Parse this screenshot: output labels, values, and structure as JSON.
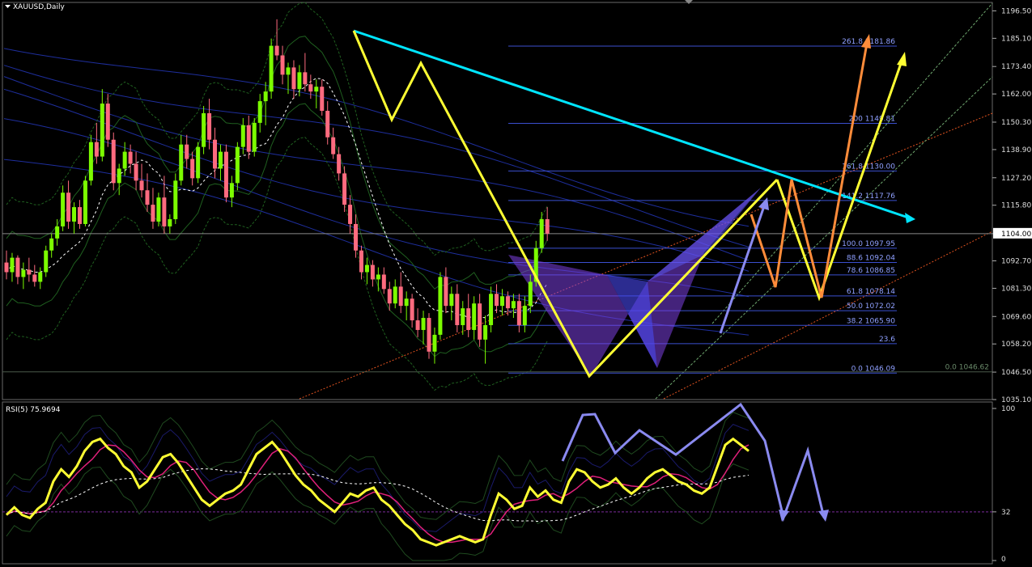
{
  "window": {
    "title": "XAUUSD,Daily",
    "menu_arrow_icon": "triangle-down-icon"
  },
  "chart_data": [
    {
      "type": "candlestick",
      "title": "XAUUSD,Daily",
      "symbol": "XAUUSD",
      "timeframe": "Daily",
      "ylim": [
        1035.1,
        1200.0
      ],
      "price_ticks": [
        "1196.50",
        "1185.10",
        "1173.40",
        "1162.00",
        "1150.30",
        "1138.90",
        "1127.20",
        "1115.80",
        "1104.00",
        "1092.70",
        "1081.30",
        "1069.60",
        "1058.20",
        "1046.50",
        "1035.10"
      ],
      "current_price": "1104.00",
      "candles_ohlc": [
        [
          1092,
          1097,
          1085,
          1088
        ],
        [
          1088,
          1096,
          1084,
          1094
        ],
        [
          1094,
          1095,
          1083,
          1086
        ],
        [
          1086,
          1092,
          1081,
          1089
        ],
        [
          1089,
          1094,
          1084,
          1087
        ],
        [
          1087,
          1091,
          1082,
          1084
        ],
        [
          1084,
          1090,
          1081,
          1088
        ],
        [
          1088,
          1099,
          1086,
          1097
        ],
        [
          1097,
          1104,
          1094,
          1102
        ],
        [
          1102,
          1110,
          1099,
          1107
        ],
        [
          1107,
          1124,
          1105,
          1121
        ],
        [
          1121,
          1126,
          1106,
          1109
        ],
        [
          1109,
          1117,
          1104,
          1115
        ],
        [
          1115,
          1118,
          1106,
          1108
        ],
        [
          1108,
          1128,
          1107,
          1126
        ],
        [
          1126,
          1145,
          1124,
          1142
        ],
        [
          1142,
          1150,
          1133,
          1136
        ],
        [
          1136,
          1164,
          1134,
          1158
        ],
        [
          1158,
          1162,
          1140,
          1143
        ],
        [
          1143,
          1146,
          1122,
          1125
        ],
        [
          1125,
          1133,
          1120,
          1131
        ],
        [
          1131,
          1142,
          1128,
          1138
        ],
        [
          1138,
          1141,
          1129,
          1133
        ],
        [
          1133,
          1138,
          1122,
          1126
        ],
        [
          1126,
          1133,
          1119,
          1122
        ],
        [
          1122,
          1129,
          1113,
          1116
        ],
        [
          1116,
          1123,
          1106,
          1109
        ],
        [
          1109,
          1121,
          1107,
          1119
        ],
        [
          1119,
          1128,
          1104,
          1107
        ],
        [
          1107,
          1112,
          1104,
          1110
        ],
        [
          1110,
          1129,
          1108,
          1126
        ],
        [
          1126,
          1145,
          1124,
          1141
        ],
        [
          1141,
          1145,
          1131,
          1135
        ],
        [
          1135,
          1138,
          1124,
          1127
        ],
        [
          1127,
          1142,
          1125,
          1140
        ],
        [
          1140,
          1157,
          1137,
          1154
        ],
        [
          1154,
          1160,
          1139,
          1143
        ],
        [
          1143,
          1148,
          1127,
          1131
        ],
        [
          1131,
          1141,
          1126,
          1138
        ],
        [
          1138,
          1141,
          1117,
          1119
        ],
        [
          1119,
          1128,
          1115,
          1125
        ],
        [
          1125,
          1142,
          1122,
          1140
        ],
        [
          1140,
          1152,
          1137,
          1149
        ],
        [
          1149,
          1153,
          1135,
          1138
        ],
        [
          1138,
          1152,
          1136,
          1150
        ],
        [
          1150,
          1162,
          1146,
          1159
        ],
        [
          1159,
          1167,
          1149,
          1163
        ],
        [
          1163,
          1185,
          1160,
          1182
        ],
        [
          1182,
          1193,
          1176,
          1178
        ],
        [
          1178,
          1182,
          1166,
          1170
        ],
        [
          1170,
          1175,
          1162,
          1173
        ],
        [
          1173,
          1176,
          1160,
          1164
        ],
        [
          1164,
          1174,
          1161,
          1171
        ],
        [
          1171,
          1179,
          1163,
          1166
        ],
        [
          1166,
          1170,
          1160,
          1163
        ],
        [
          1163,
          1168,
          1156,
          1165
        ],
        [
          1165,
          1168,
          1153,
          1155
        ],
        [
          1155,
          1159,
          1141,
          1144
        ],
        [
          1144,
          1148,
          1135,
          1137
        ],
        [
          1137,
          1140,
          1126,
          1129
        ],
        [
          1129,
          1132,
          1113,
          1116
        ],
        [
          1116,
          1120,
          1104,
          1108
        ],
        [
          1108,
          1112,
          1094,
          1097
        ],
        [
          1097,
          1099,
          1085,
          1088
        ],
        [
          1088,
          1094,
          1083,
          1091
        ],
        [
          1091,
          1093,
          1082,
          1085
        ],
        [
          1085,
          1090,
          1080,
          1087
        ],
        [
          1087,
          1090,
          1079,
          1081
        ],
        [
          1081,
          1084,
          1072,
          1075
        ],
        [
          1075,
          1085,
          1073,
          1082
        ],
        [
          1082,
          1088,
          1071,
          1074
        ],
        [
          1074,
          1080,
          1068,
          1077
        ],
        [
          1077,
          1079,
          1065,
          1068
        ],
        [
          1068,
          1073,
          1061,
          1064
        ],
        [
          1064,
          1072,
          1058,
          1069
        ],
        [
          1069,
          1071,
          1052,
          1055
        ],
        [
          1055,
          1065,
          1050,
          1062
        ],
        [
          1062,
          1088,
          1060,
          1086
        ],
        [
          1086,
          1090,
          1071,
          1074
        ],
        [
          1074,
          1082,
          1068,
          1079
        ],
        [
          1079,
          1083,
          1063,
          1066
        ],
        [
          1066,
          1076,
          1062,
          1073
        ],
        [
          1073,
          1079,
          1061,
          1064
        ],
        [
          1064,
          1078,
          1060,
          1075
        ],
        [
          1075,
          1079,
          1057,
          1060
        ],
        [
          1060,
          1070,
          1050,
          1066
        ],
        [
          1066,
          1082,
          1063,
          1079
        ],
        [
          1079,
          1083,
          1071,
          1074
        ],
        [
          1074,
          1081,
          1070,
          1078
        ],
        [
          1078,
          1080,
          1070,
          1073
        ],
        [
          1073,
          1079,
          1069,
          1076
        ],
        [
          1076,
          1079,
          1063,
          1066
        ],
        [
          1066,
          1078,
          1063,
          1074
        ],
        [
          1074,
          1087,
          1071,
          1084
        ],
        [
          1084,
          1101,
          1082,
          1098
        ],
        [
          1098,
          1113,
          1096,
          1110
        ],
        [
          1110,
          1115,
          1101,
          1104
        ]
      ],
      "fibonacci_levels": [
        {
          "label": "261.8 1181.86",
          "price": 1181.86
        },
        {
          "label": "200 1149.81",
          "price": 1149.81
        },
        {
          "label": "161.8 1130.00",
          "price": 1130.0
        },
        {
          "label": "141.2 1117.76",
          "price": 1117.76
        },
        {
          "label": "100.0 1097.95",
          "price": 1097.95
        },
        {
          "label": "88.6 1092.04",
          "price": 1092.04
        },
        {
          "label": "78.6 1086.85",
          "price": 1086.85
        },
        {
          "label": "61.8 1078.14",
          "price": 1078.14
        },
        {
          "label": "50.0 1072.02",
          "price": 1072.02
        },
        {
          "label": "38.2 1065.90",
          "price": 1065.9
        },
        {
          "label": "23.6",
          "price": 1058.3
        },
        {
          "label": "0.0 1046.09",
          "price": 1046.09
        }
      ],
      "extra_level_label": "0.0 1046.62",
      "colors": {
        "bull_candle": "#7CFC00",
        "bear_candle": "#FF6B7F",
        "trendline": "#00E5FF",
        "zigzag": "#FFFF33",
        "projection_orange": "#FF8C3A",
        "projection_blue": "#8A8AF0",
        "harmonic_fill": "#7B3FE0",
        "fib_line": "#3B4FCF",
        "moving_average_blue": "#1E2E9C",
        "envelope_green": "#1F5F1F",
        "median_white": "#FFFFFF"
      }
    },
    {
      "type": "line",
      "title": "RSI(5) 75.9694",
      "ylim": [
        0,
        100
      ],
      "y_ticks": [
        "100",
        "32",
        "0"
      ],
      "level": 32,
      "series": [
        {
          "name": "RSI(5)",
          "color": "#FFFF33",
          "values": [
            30,
            35,
            30,
            28,
            34,
            38,
            52,
            60,
            55,
            62,
            72,
            78,
            80,
            74,
            70,
            62,
            58,
            48,
            52,
            60,
            68,
            70,
            64,
            56,
            48,
            40,
            36,
            40,
            44,
            46,
            50,
            60,
            70,
            74,
            78,
            72,
            64,
            56,
            50,
            46,
            40,
            36,
            32,
            38,
            44,
            42,
            46,
            48,
            40,
            36,
            30,
            24,
            20,
            14,
            12,
            10,
            12,
            14,
            16,
            14,
            12,
            14,
            30,
            44,
            40,
            34,
            36,
            48,
            42,
            46,
            40,
            38,
            52,
            60,
            58,
            52,
            48,
            50,
            54,
            48,
            44,
            48,
            54,
            58,
            60,
            56,
            52,
            50,
            46,
            44,
            48,
            62,
            76,
            80,
            76,
            72
          ]
        }
      ]
    }
  ]
}
